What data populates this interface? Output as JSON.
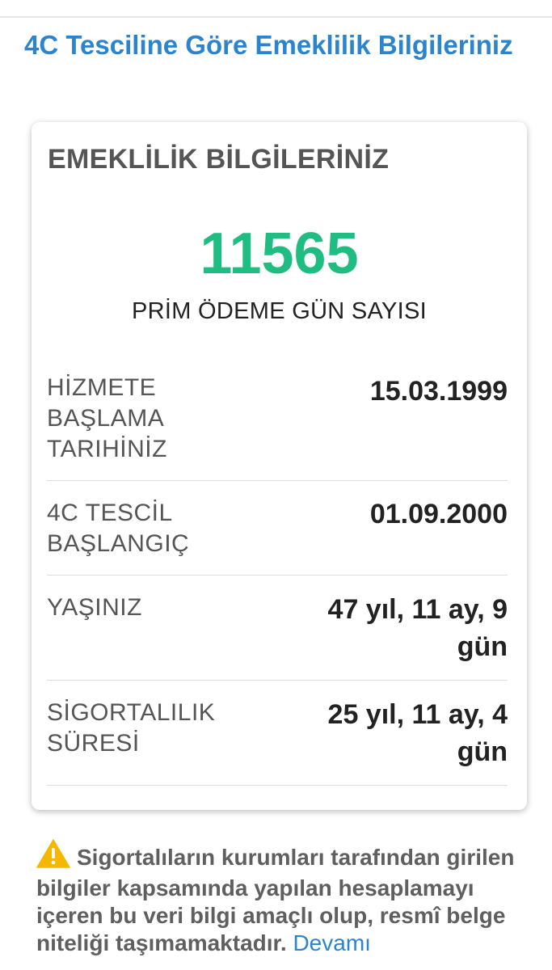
{
  "page": {
    "title": "4C Tesciline Göre Emeklilik Bilgileriniz"
  },
  "card": {
    "title": "EMEKLİLİK BİLGİLERİNİZ",
    "prim_number": "11565",
    "prim_label": "PRİM ÖDEME GÜN SAYISI",
    "rows": [
      {
        "label": "HİZMETE BAŞLAMA TARIHİNİZ",
        "value": "15.03.1999"
      },
      {
        "label": "4C TESCİL BAŞLANGIÇ",
        "value": "01.09.2000"
      },
      {
        "label": "YAŞINIZ",
        "value": "47 yıl, 11 ay, 9 gün"
      },
      {
        "label": "SİGORTALILIK SÜRESİ",
        "value": "25 yıl, 11 ay, 4 gün"
      }
    ]
  },
  "notice": {
    "icon": "warning-icon",
    "line1": "Sigortalıların kurumları tarafından girilen",
    "line2": "bilgiler kapsamında yapılan hesaplamayı",
    "line3": "içeren bu veri bilgi amaçlı olup, resmî belge",
    "line4": "niteliği taşımamaktadır.",
    "more_label": "Devamı"
  },
  "colors": {
    "accent_blue": "#2b84cc",
    "number_green": "#1fbd82",
    "warning_yellow": "#f5b800"
  }
}
